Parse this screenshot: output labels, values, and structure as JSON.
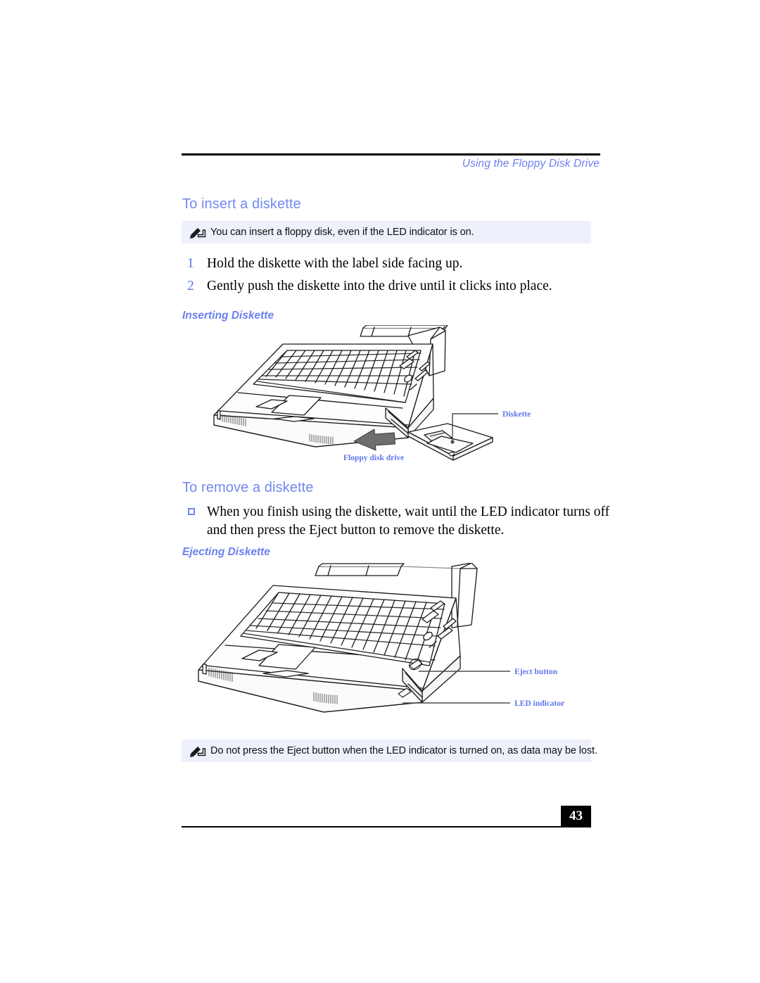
{
  "header": {
    "title": "Using the Floppy Disk Drive"
  },
  "sections": {
    "insert": {
      "heading": "To insert a diskette",
      "note": {
        "icon": "note-pencil-icon",
        "text": "You can insert a floppy disk, even if the LED indicator is on."
      },
      "steps": [
        {
          "number": "1",
          "text": "Hold the diskette with the label side facing up."
        },
        {
          "number": "2",
          "text": "Gently push the diskette into the drive until it clicks into place."
        }
      ],
      "figure": {
        "caption": "Inserting Diskette",
        "callouts": [
          {
            "label": "Diskette"
          },
          {
            "label": "Floppy disk drive"
          }
        ]
      }
    },
    "remove": {
      "heading": "To remove a diskette",
      "bullet": {
        "line1": "When you finish using the diskette, wait until the LED indicator turns off",
        "line2": "and then press the Eject button to remove the diskette."
      },
      "figure": {
        "caption": "Ejecting Diskette",
        "callouts": [
          {
            "label": "Eject button"
          },
          {
            "label": "LED indicator"
          }
        ]
      },
      "note": {
        "icon": "note-pencil-icon",
        "text": "Do not press the Eject button when the LED indicator is turned on, as data may be lost."
      }
    }
  },
  "footer": {
    "page_number": "43"
  },
  "colors": {
    "heading_blue": "#7289ef",
    "caption_blue": "#6b80ef",
    "callout_blue": "#5c78ea",
    "note_background": "#eef0fb",
    "rule_black": "#000000"
  }
}
